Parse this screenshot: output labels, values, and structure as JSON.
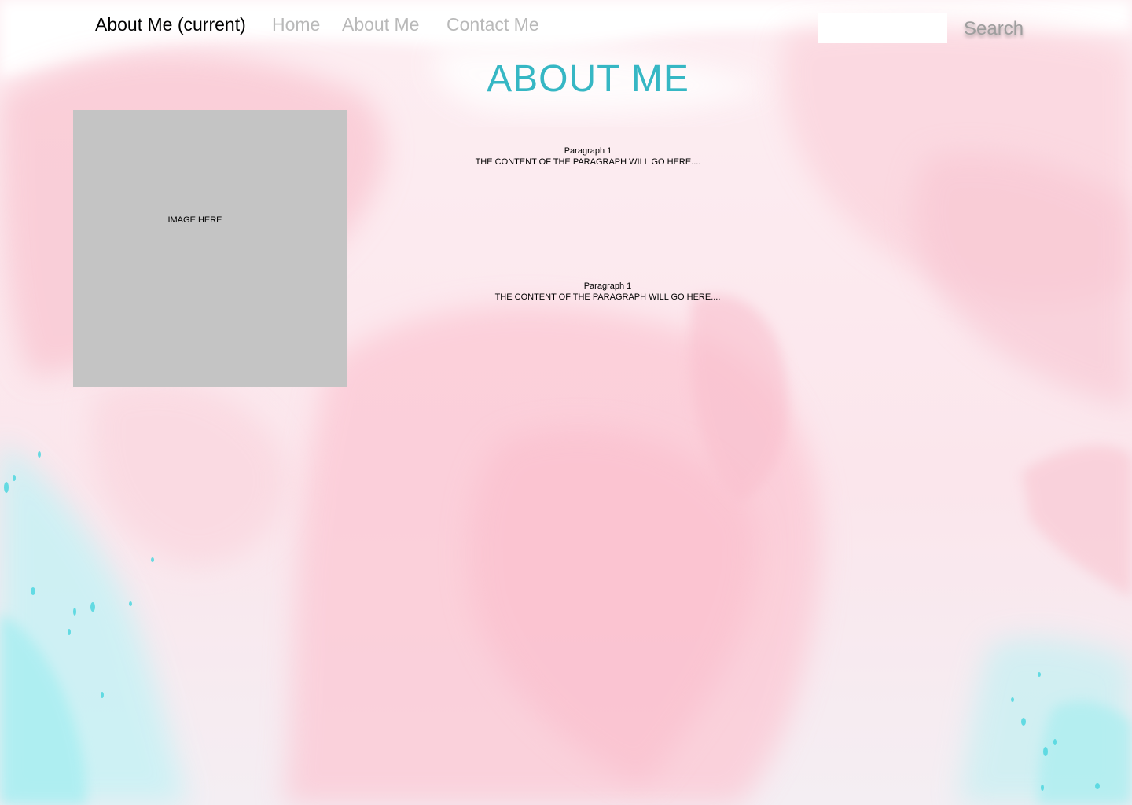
{
  "nav": {
    "current_label": "About Me (current)",
    "items": [
      {
        "label": "Home"
      },
      {
        "label": "About Me"
      },
      {
        "label": "Contact Me"
      }
    ]
  },
  "search": {
    "placeholder": "",
    "value": "",
    "button_label": "Search"
  },
  "page_title": "ABOUT ME",
  "image": {
    "label": "IMAGE HERE"
  },
  "paragraphs": [
    {
      "heading": "Paragraph 1",
      "body": "THE CONTENT OF THE PARAGRAPH WILL GO HERE...."
    },
    {
      "heading": "Paragraph 1",
      "body": "THE CONTENT OF THE PARAGRAPH WILL GO HERE...."
    }
  ],
  "colors": {
    "title": "#36b7c4",
    "nav_inactive": "#b9b9b9",
    "image_placeholder": "#c4c4c4",
    "background_pink": "#fbd0dc",
    "background_cyan": "#b4f0f3"
  }
}
